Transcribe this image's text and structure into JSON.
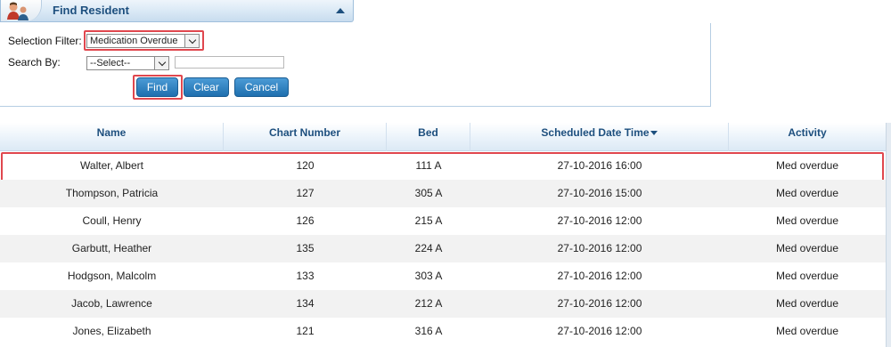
{
  "panel": {
    "title": "Find Resident"
  },
  "search": {
    "selection_filter_label": "Selection Filter:",
    "selection_filter_value": "Medication Overdue",
    "search_by_label": "Search By:",
    "search_by_value": "--Select--",
    "search_text_value": ""
  },
  "buttons": {
    "find": "Find",
    "clear": "Clear",
    "cancel": "Cancel"
  },
  "table": {
    "columns": [
      "Name",
      "Chart Number",
      "Bed",
      "Scheduled Date Time",
      "Activity"
    ],
    "sorted_column": "Scheduled Date Time",
    "sort_direction": "descending",
    "highlighted_row": 0,
    "rows": [
      {
        "name": "Walter, Albert",
        "chart": "120",
        "bed": "111 A",
        "datetime": "27-10-2016 16:00",
        "activity": "Med overdue"
      },
      {
        "name": "Thompson, Patricia",
        "chart": "127",
        "bed": "305 A",
        "datetime": "27-10-2016 15:00",
        "activity": "Med overdue"
      },
      {
        "name": "Coull, Henry",
        "chart": "126",
        "bed": "215 A",
        "datetime": "27-10-2016 12:00",
        "activity": "Med overdue"
      },
      {
        "name": "Garbutt, Heather",
        "chart": "135",
        "bed": "224 A",
        "datetime": "27-10-2016 12:00",
        "activity": "Med overdue"
      },
      {
        "name": "Hodgson, Malcolm",
        "chart": "133",
        "bed": "303 A",
        "datetime": "27-10-2016 12:00",
        "activity": "Med overdue"
      },
      {
        "name": "Jacob, Lawrence",
        "chart": "134",
        "bed": "212 A",
        "datetime": "27-10-2016 12:00",
        "activity": "Med overdue"
      },
      {
        "name": "Jones, Elizabeth",
        "chart": "121",
        "bed": "316 A",
        "datetime": "27-10-2016 12:00",
        "activity": "Med overdue"
      }
    ]
  },
  "colors": {
    "header_text": "#1d4f7e",
    "button": "#2a7dbd",
    "highlight": "#e0474e",
    "row_alt": "#f2f2f2"
  },
  "icons": {
    "header": "resident-group-icon",
    "collapse": "chevron-up-icon",
    "sort": "sort-descending-icon",
    "dropdown": "chevron-down-icon"
  }
}
